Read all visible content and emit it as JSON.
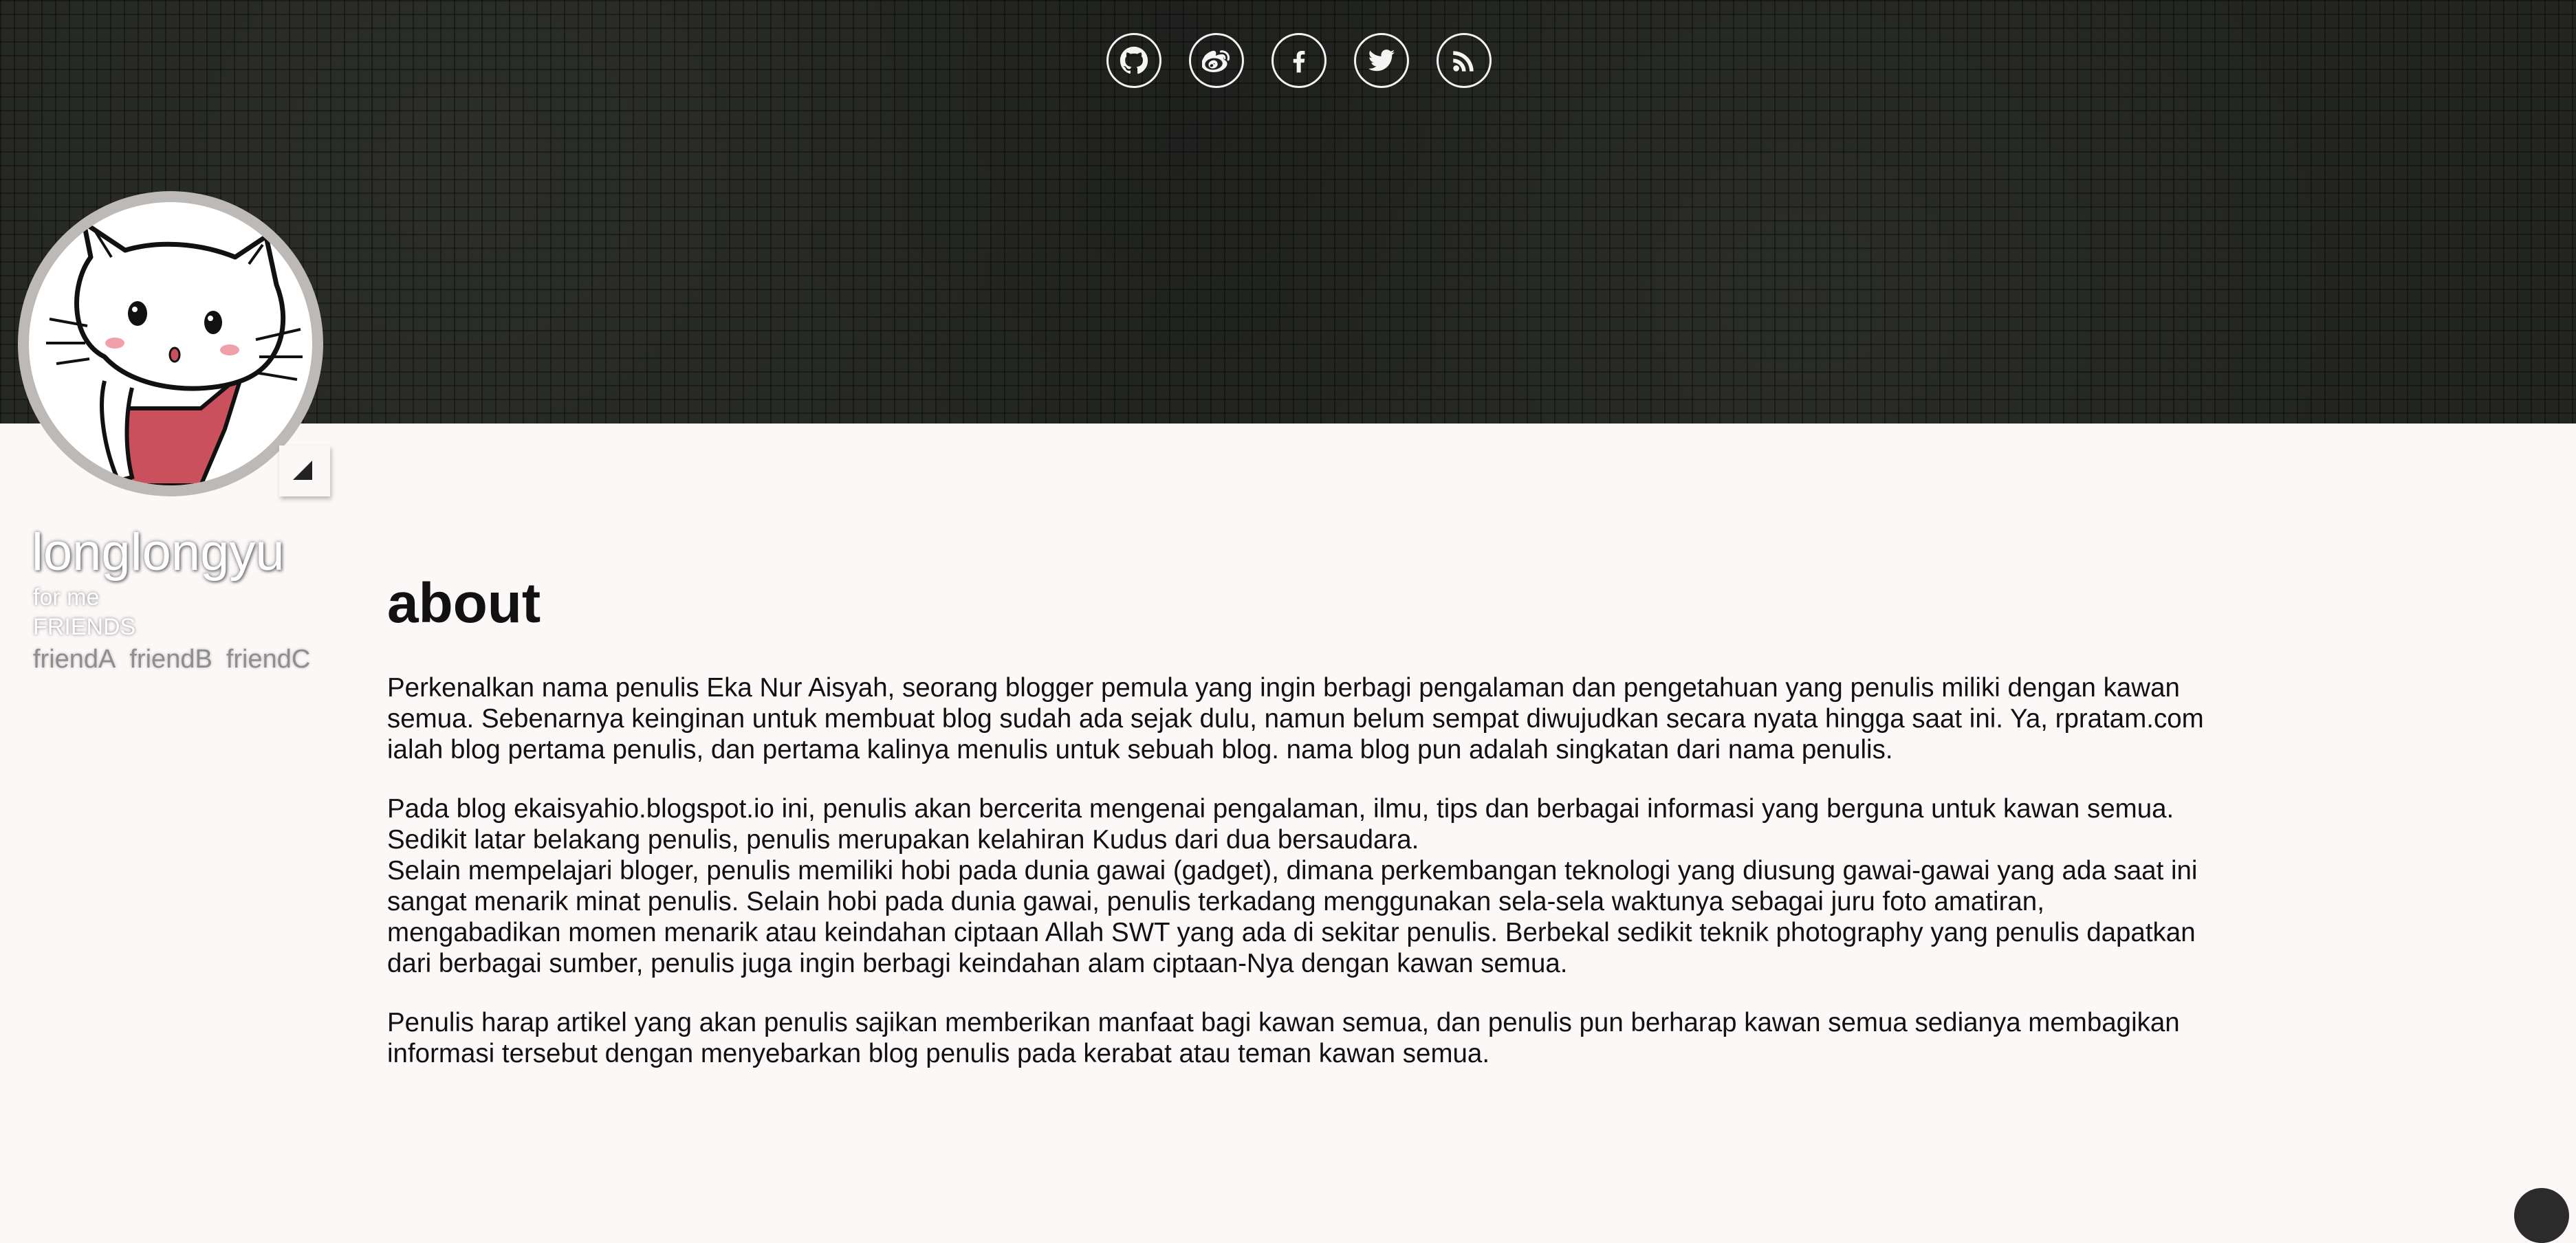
{
  "social": [
    {
      "name": "github-icon",
      "label": "GitHub"
    },
    {
      "name": "weibo-icon",
      "label": "Weibo"
    },
    {
      "name": "facebook-icon",
      "label": "Facebook"
    },
    {
      "name": "twitter-icon",
      "label": "Twitter"
    },
    {
      "name": "rss-icon",
      "label": "RSS"
    }
  ],
  "sidebar": {
    "title": "longlongyu",
    "subtitle": "for me",
    "friends_heading": "FRIENDS",
    "friends": [
      "friendA",
      "friendB",
      "friendC"
    ]
  },
  "main": {
    "heading": "about",
    "paragraphs": [
      "Perkenalkan nama penulis Eka Nur Aisyah, seorang blogger pemula yang ingin berbagi pengalaman dan pengetahuan yang penulis miliki dengan kawan semua. Sebenarnya keinginan untuk membuat blog sudah ada sejak dulu, namun belum sempat diwujudkan secara nyata hingga saat ini. Ya, rpratam.com ialah blog pertama penulis, dan pertama kalinya menulis untuk sebuah blog. nama blog pun adalah singkatan dari nama penulis.",
      "Pada blog ekaisyahio.blogspot.io ini, penulis akan bercerita mengenai pengalaman, ilmu, tips dan berbagai informasi yang berguna untuk kawan semua. Sedikit latar belakang penulis, penulis merupakan kelahiran Kudus dari dua bersaudara.",
      "Selain mempelajari bloger, penulis memiliki hobi pada dunia gawai (gadget), dimana perkembangan teknologi yang diusung gawai-gawai yang ada saat ini sangat menarik minat penulis. Selain hobi pada dunia gawai, penulis terkadang menggunakan sela-sela waktunya sebagai juru foto amatiran, mengabadikan momen menarik atau keindahan ciptaan Allah SWT yang ada di sekitar penulis. Berbekal sedikit teknik photography yang penulis dapatkan dari berbagai sumber, penulis juga ingin berbagi keindahan alam ciptaan-Nya dengan kawan semua.",
      "Penulis harap artikel yang akan penulis sajikan memberikan manfaat bagi kawan semua, dan penulis pun berharap kawan semua sedianya membagikan informasi tersebut dengan menyebarkan blog penulis pada kerabat atau teman kawan semua."
    ]
  }
}
